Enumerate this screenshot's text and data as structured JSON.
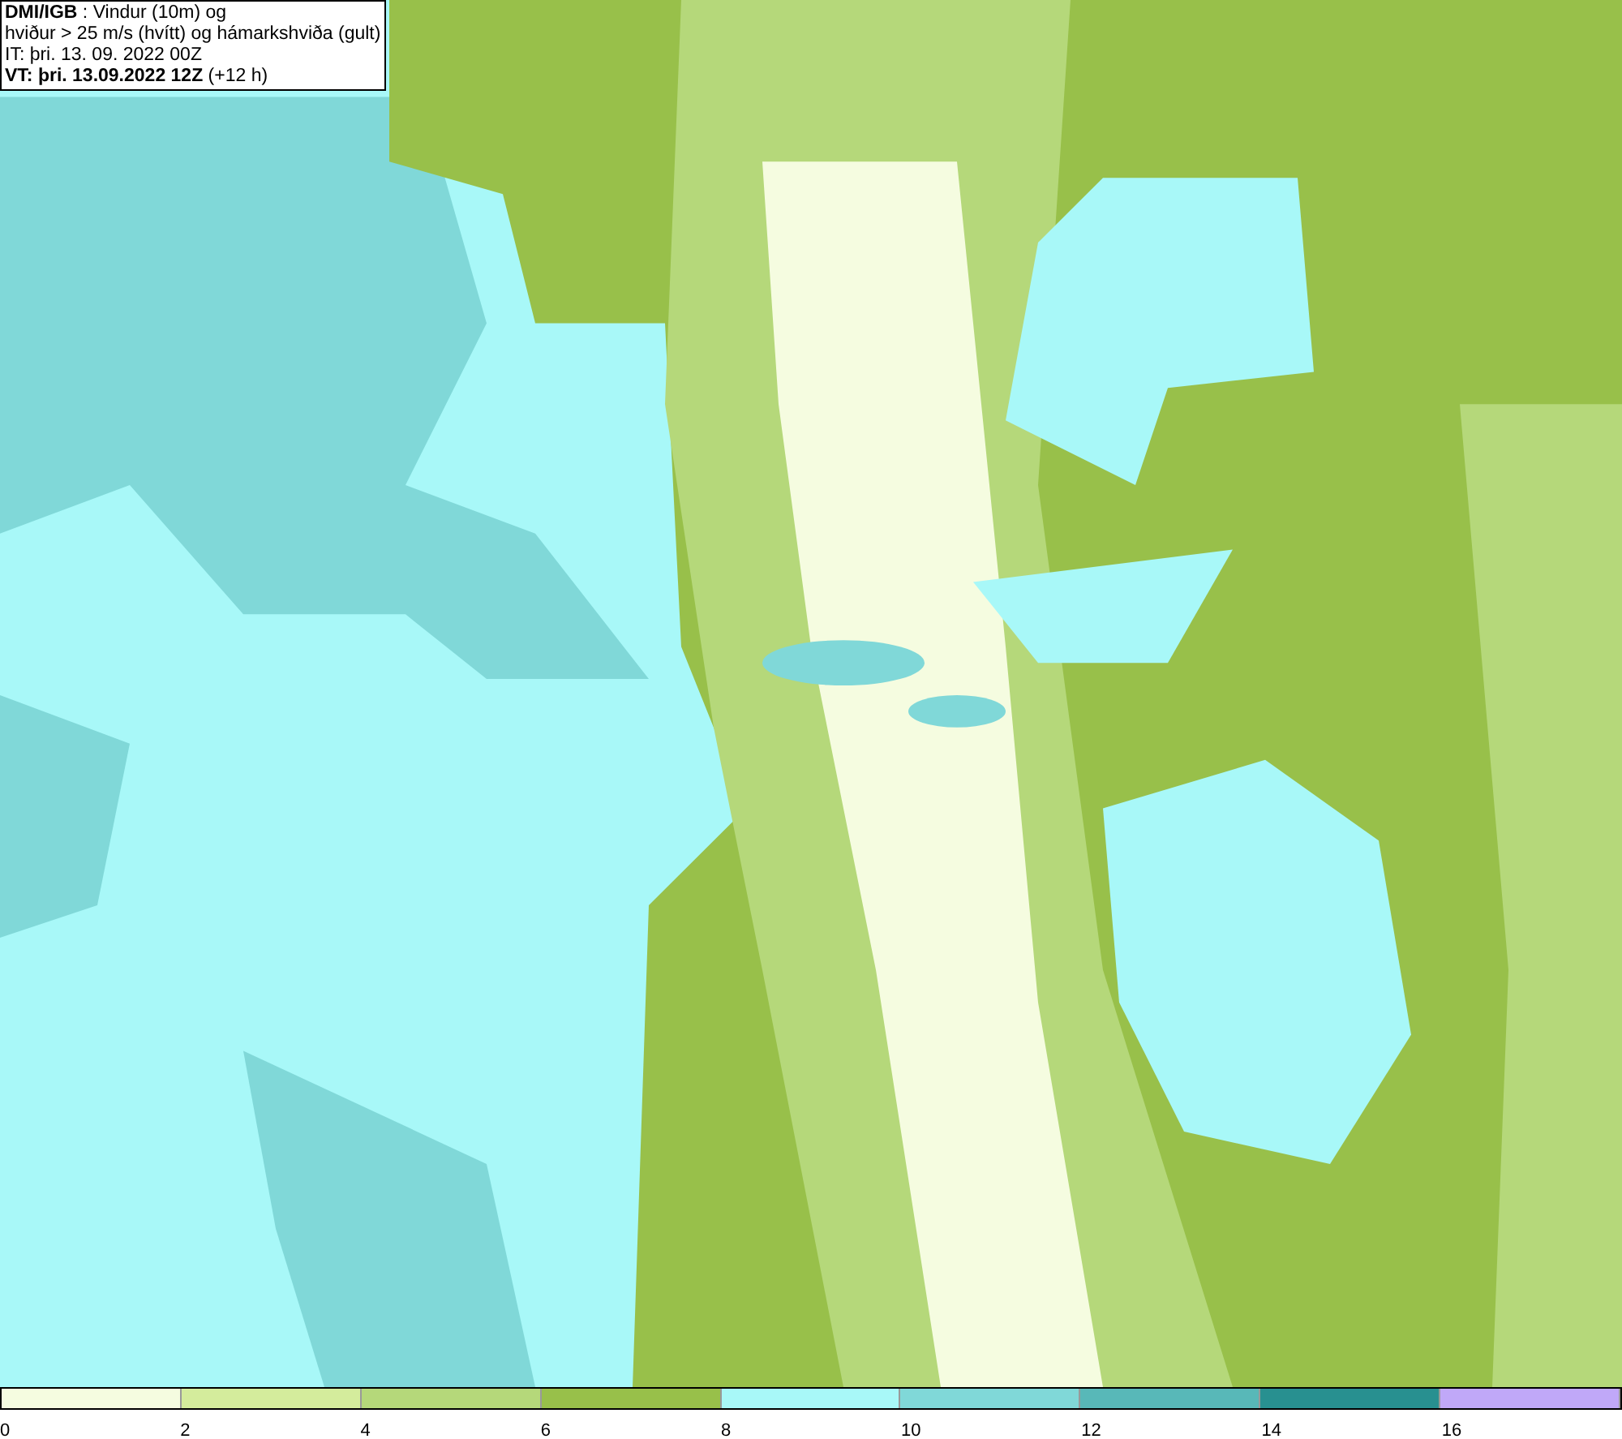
{
  "header": {
    "lines": [
      "**DMI/IGB** : Vindur (10m) og",
      "hviður > 25 m/s (hvítt) og hámarkshviða (gult)",
      "IT: þri. 13. 09. 2022 00Z",
      "**VT: þri. 13.09.2022 12Z** (+12 h)"
    ]
  },
  "legend": [
    {
      "label": "0",
      "color": "#f5fce0"
    },
    {
      "label": "2",
      "color": "#d4ec9c"
    },
    {
      "label": "4",
      "color": "#b5d87a"
    },
    {
      "label": "6",
      "color": "#98c04a"
    },
    {
      "label": "8",
      "color": "#a8f8f8"
    },
    {
      "label": "10",
      "color": "#80d8d8"
    },
    {
      "label": "12",
      "color": "#58b8b8"
    },
    {
      "label": "14",
      "color": "#289090"
    },
    {
      "label": "16",
      "color": "#c0a8f8"
    }
  ]
}
